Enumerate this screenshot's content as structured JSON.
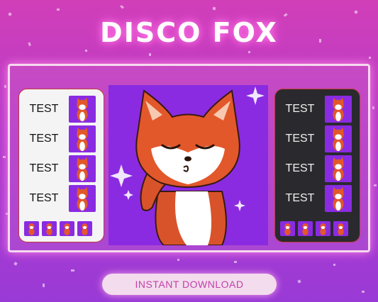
{
  "title": "DISCO FOX",
  "cta": {
    "label": "INSTANT DOWNLOAD"
  },
  "panels": {
    "light": {
      "rows": [
        "TEST",
        "TEST",
        "TEST",
        "TEST"
      ]
    },
    "dark": {
      "rows": [
        "TEST",
        "TEST",
        "TEST",
        "TEST"
      ]
    }
  },
  "colors": {
    "background_top": "#d13fb8",
    "background_bottom": "#9a3ad6",
    "emote_bg": "#8a2be2",
    "fox_orange": "#e2582b",
    "cta_text": "#c241a8"
  },
  "icons": {
    "hero": "fox-kiss-icon",
    "thumb": "fox-emote-icon"
  }
}
